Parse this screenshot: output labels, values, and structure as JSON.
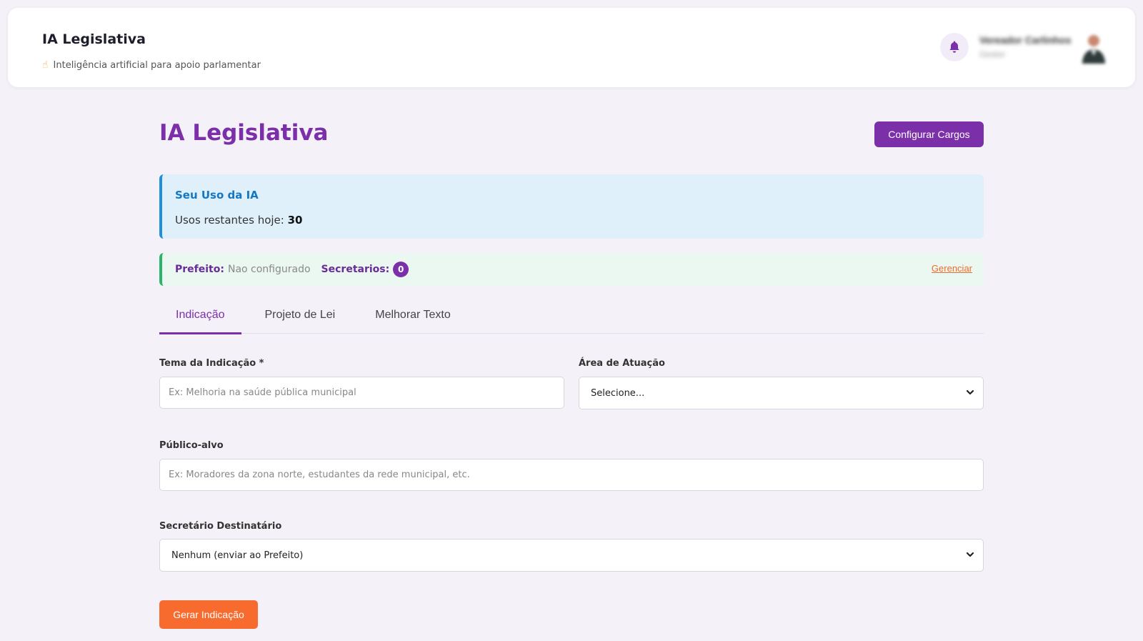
{
  "header": {
    "title": "IA Legislativa",
    "subtitle": "Inteligência artificial para apoio parlamentar",
    "user_name": "Vereador Carlinhos",
    "user_role": "Gestor"
  },
  "main": {
    "page_title": "IA Legislativa",
    "configure_button": "Configurar Cargos",
    "usage": {
      "title": "Seu Uso da IA",
      "remaining_label": "Usos restantes hoje:",
      "remaining_value": "30"
    },
    "cargos": {
      "prefeito_label": "Prefeito:",
      "prefeito_value": "Nao configurado",
      "secretarios_label": "Secretarios:",
      "secretarios_count": "0",
      "manage_link": "Gerenciar"
    },
    "tabs": [
      {
        "label": "Indicação",
        "active": true
      },
      {
        "label": "Projeto de Lei",
        "active": false
      },
      {
        "label": "Melhorar Texto",
        "active": false
      }
    ],
    "form": {
      "tema_label": "Tema da Indicação *",
      "tema_placeholder": "Ex: Melhoria na saúde pública municipal",
      "area_label": "Área de Atuação",
      "area_selected": "Selecione...",
      "publico_label": "Público-alvo",
      "publico_placeholder": "Ex: Moradores da zona norte, estudantes da rede municipal, etc.",
      "secretario_label": "Secretário Destinatário",
      "secretario_selected": "Nenhum (enviar ao Prefeito)",
      "submit_label": "Gerar Indicação"
    }
  },
  "colors": {
    "primary": "#7b2fa8",
    "accent": "#f86b2e",
    "info_bg": "#dff0fb",
    "info_border": "#1e8fd8",
    "success_bg": "#ebf8f1",
    "success_border": "#2bb56a"
  }
}
